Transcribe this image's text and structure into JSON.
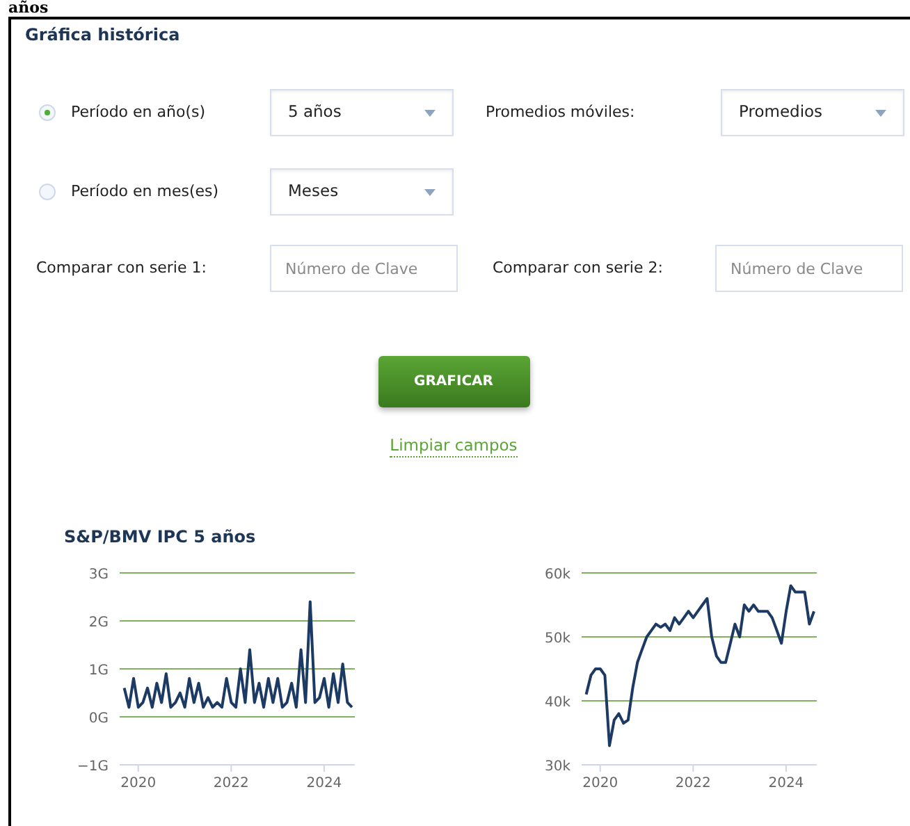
{
  "heading": "años",
  "panel": {
    "title": "Gráfica histórica",
    "period_options": [
      {
        "label": "Período en año(s)",
        "selected": true,
        "select": {
          "value": "5 años"
        }
      },
      {
        "label": "Período en mes(es)",
        "selected": false,
        "select": {
          "value": "Meses"
        }
      }
    ],
    "moving_averages": {
      "label": "Promedios móviles:",
      "select": {
        "value": "Promedios"
      }
    },
    "compare_fields": [
      {
        "label": "Comparar con serie 1:",
        "placeholder": "Número de Clave"
      },
      {
        "label": "Comparar con serie 2:",
        "placeholder": "Número de Clave"
      }
    ],
    "submit_button": "GRAFICAR",
    "clear_link": "Limpiar campos",
    "chart_title": "S&P/BMV IPC 5 años",
    "charts": [
      {
        "chart_data": {
          "type": "line",
          "x": [
            2019.7,
            2019.8,
            2019.9,
            2020.0,
            2020.1,
            2020.2,
            2020.3,
            2020.4,
            2020.5,
            2020.6,
            2020.7,
            2020.8,
            2020.9,
            2021.0,
            2021.1,
            2021.2,
            2021.3,
            2021.4,
            2021.5,
            2021.6,
            2021.7,
            2021.8,
            2021.9,
            2022.0,
            2022.1,
            2022.2,
            2022.3,
            2022.4,
            2022.5,
            2022.6,
            2022.7,
            2022.8,
            2022.9,
            2023.0,
            2023.1,
            2023.2,
            2023.3,
            2023.4,
            2023.5,
            2023.6,
            2023.7,
            2023.8,
            2023.9,
            2024.0,
            2024.1,
            2024.2,
            2024.3,
            2024.4,
            2024.5,
            2024.6
          ],
          "series": [
            {
              "color": "#1c3a63",
              "values": [
                0.6,
                0.2,
                0.8,
                0.2,
                0.3,
                0.6,
                0.2,
                0.7,
                0.3,
                0.9,
                0.2,
                0.3,
                0.5,
                0.2,
                0.8,
                0.3,
                0.7,
                0.2,
                0.4,
                0.2,
                0.3,
                0.2,
                0.8,
                0.3,
                0.2,
                1.0,
                0.3,
                1.4,
                0.3,
                0.7,
                0.2,
                0.8,
                0.3,
                0.8,
                0.2,
                0.3,
                0.7,
                0.2,
                1.4,
                0.3,
                2.4,
                0.3,
                0.4,
                0.8,
                0.2,
                0.9,
                0.3,
                1.1,
                0.3,
                0.2
              ]
            }
          ],
          "xlim": [
            2019.6,
            2024.6
          ],
          "ylim": [
            -1,
            3
          ],
          "grid": true,
          "xticks": [
            2020,
            2022,
            2024
          ],
          "yticks": [
            {
              "value": 3,
              "label": "3G"
            },
            {
              "value": 2,
              "label": "2G"
            },
            {
              "value": 1,
              "label": "1G"
            },
            {
              "value": 0,
              "label": "0G"
            },
            {
              "value": -1,
              "label": "−1G"
            }
          ]
        }
      },
      {
        "chart_data": {
          "type": "line",
          "x": [
            2019.7,
            2019.8,
            2019.9,
            2020.0,
            2020.1,
            2020.2,
            2020.3,
            2020.4,
            2020.5,
            2020.6,
            2020.7,
            2020.8,
            2020.9,
            2021.0,
            2021.1,
            2021.2,
            2021.3,
            2021.4,
            2021.5,
            2021.6,
            2021.7,
            2021.8,
            2021.9,
            2022.0,
            2022.1,
            2022.2,
            2022.3,
            2022.4,
            2022.5,
            2022.6,
            2022.7,
            2022.8,
            2022.9,
            2023.0,
            2023.1,
            2023.2,
            2023.3,
            2023.4,
            2023.5,
            2023.6,
            2023.7,
            2023.8,
            2023.9,
            2024.0,
            2024.1,
            2024.2,
            2024.3,
            2024.4,
            2024.5,
            2024.6
          ],
          "series": [
            {
              "color": "#1c3a63",
              "values": [
                41,
                44,
                45,
                45,
                44,
                33,
                37,
                38,
                36.5,
                37,
                42,
                46,
                48,
                50,
                51,
                52,
                51.5,
                52,
                51,
                53,
                52,
                53,
                54,
                53,
                54,
                55,
                56,
                50,
                47,
                46,
                46,
                49,
                52,
                50,
                55,
                54,
                55,
                54,
                54,
                54,
                53,
                51,
                49,
                54,
                58,
                57,
                57,
                57,
                52,
                54
              ]
            }
          ],
          "xlim": [
            2019.6,
            2024.6
          ],
          "ylim": [
            30,
            60
          ],
          "grid": true,
          "xticks": [
            2020,
            2022,
            2024
          ],
          "yticks": [
            {
              "value": 60,
              "label": "60k"
            },
            {
              "value": 50,
              "label": "50k"
            },
            {
              "value": 40,
              "label": "40k"
            },
            {
              "value": 30,
              "label": "30k"
            }
          ]
        }
      }
    ]
  }
}
